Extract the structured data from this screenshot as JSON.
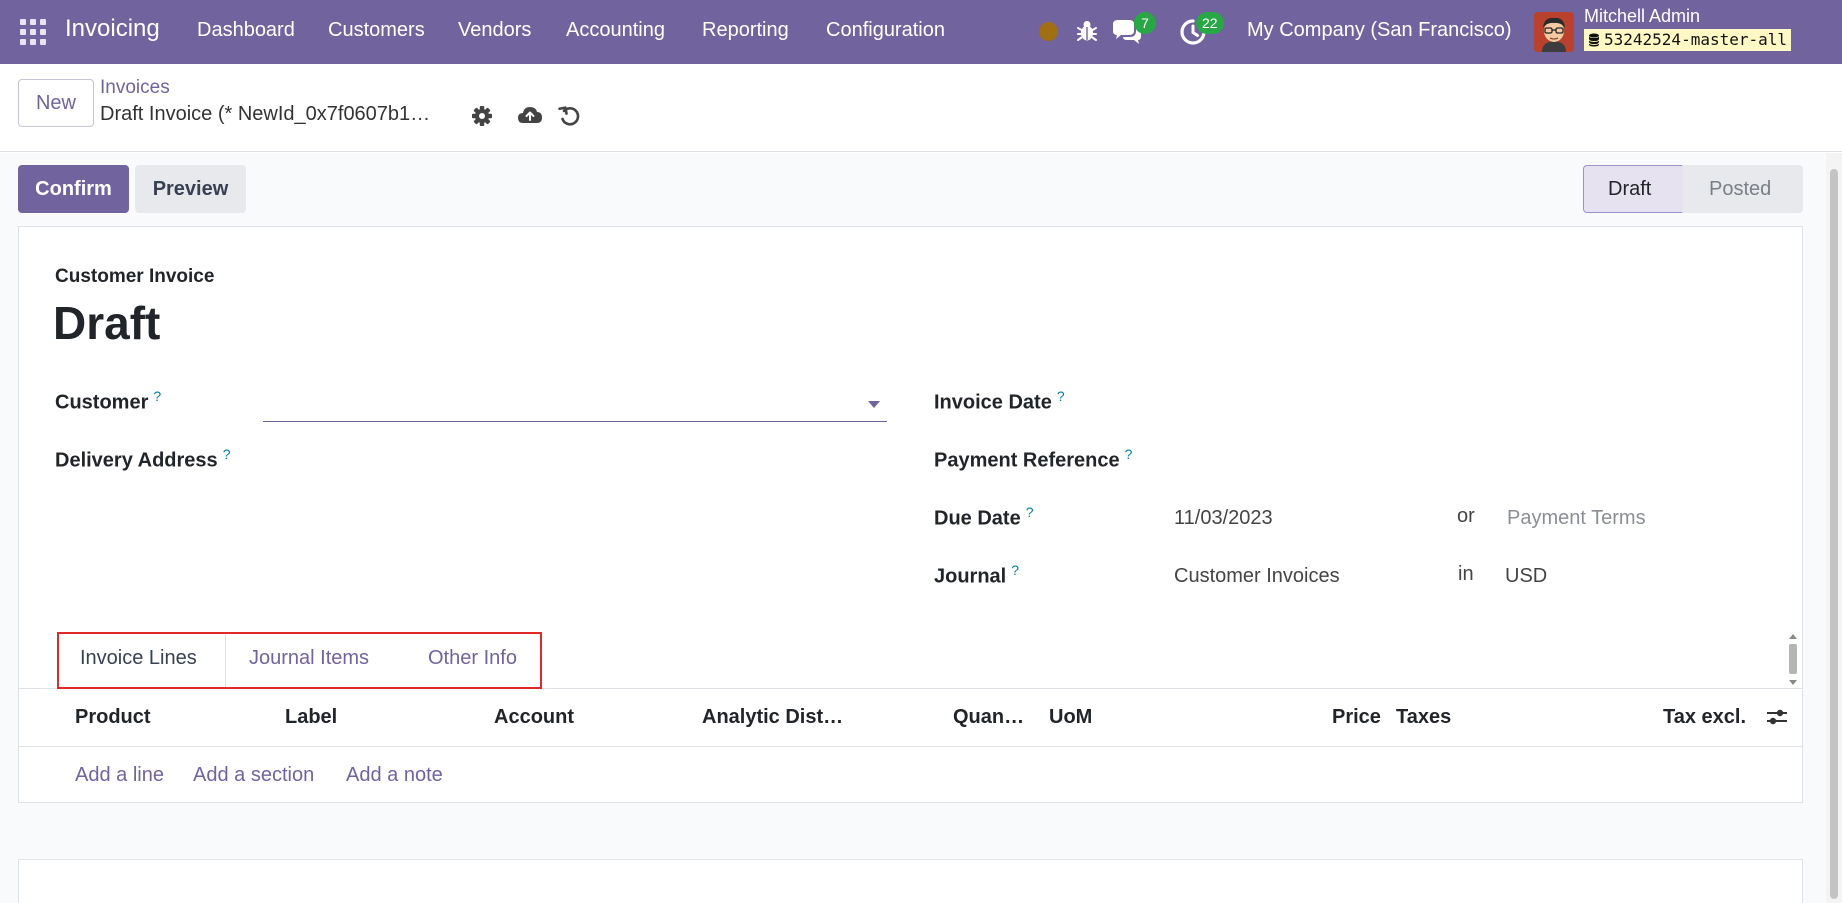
{
  "navbar": {
    "app_name": "Invoicing",
    "menus": [
      "Dashboard",
      "Customers",
      "Vendors",
      "Accounting",
      "Reporting",
      "Configuration"
    ],
    "messages_count": "7",
    "activities_count": "22",
    "company": "My Company (San Francisco)",
    "user_name": "Mitchell Admin",
    "database": "53242524-master-all",
    "color": "#71639e"
  },
  "control": {
    "new_label": "New",
    "breadcrumb_parent": "Invoices",
    "breadcrumb_current": "Draft Invoice (* NewId_0x7f0607b1…"
  },
  "statusbar": {
    "confirm_label": "Confirm",
    "preview_label": "Preview",
    "stages": [
      "Draft",
      "Posted"
    ],
    "active_stage": "Draft"
  },
  "form": {
    "doc_type": "Customer Invoice",
    "title": "Draft",
    "fields": {
      "customer_label": "Customer",
      "delivery_address_label": "Delivery Address",
      "invoice_date_label": "Invoice Date",
      "payment_reference_label": "Payment Reference",
      "due_date_label": "Due Date",
      "due_date_value": "11/03/2023",
      "due_or": "or",
      "payment_terms_placeholder": "Payment Terms",
      "journal_label": "Journal",
      "journal_value": "Customer Invoices",
      "journal_in": "in",
      "currency_value": "USD",
      "help_mark": "?"
    }
  },
  "tabs": [
    "Invoice Lines",
    "Journal Items",
    "Other Info"
  ],
  "lines_table": {
    "columns": [
      "Product",
      "Label",
      "Account",
      "Analytic Dist…",
      "Quan…",
      "UoM",
      "Price",
      "Taxes",
      "Tax excl."
    ],
    "actions": [
      "Add a line",
      "Add a section",
      "Add a note"
    ]
  }
}
